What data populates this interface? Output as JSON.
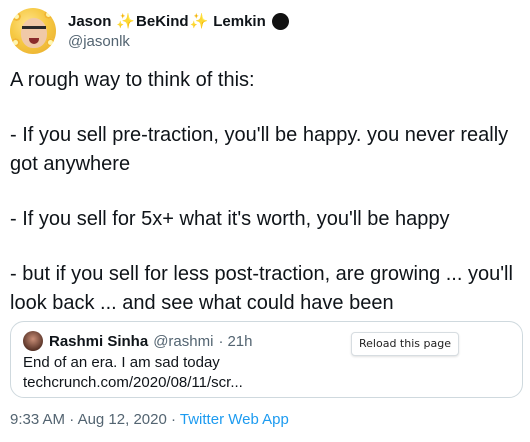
{
  "author": {
    "name_first": "Jason",
    "name_middle": "BeKind",
    "name_last": "Lemkin",
    "handle": "@jasonlk",
    "sparkle": "✨"
  },
  "body": {
    "paragraphs": [
      "A rough way to think of this:",
      "- If you sell pre-traction, you'll be happy. you never really got anywhere",
      "- If you sell for 5x+ what it's worth, you'll be happy",
      "- but if you sell for less post-traction, are growing ... you'll look back ... and see what could have been"
    ]
  },
  "quote": {
    "name": "Rashmi Sinha",
    "handle": "@rashmi",
    "separator": "·",
    "time": "21h",
    "text_line1": "End of an era. I am sad today",
    "text_line2": "techcrunch.com/2020/08/11/scr...",
    "reload_label": "Reload this page"
  },
  "footer": {
    "time": "9:33 AM",
    "dot1": "·",
    "date": "Aug 12, 2020",
    "dot2": "·",
    "app": "Twitter Web App"
  },
  "colors": {
    "text": "#0f1419",
    "secondary": "#536471",
    "link": "#1d9bf0",
    "border": "#cfd9de",
    "sparkle": "#f4b33d"
  },
  "icons": {
    "verified": "black-dot-badge-icon"
  }
}
